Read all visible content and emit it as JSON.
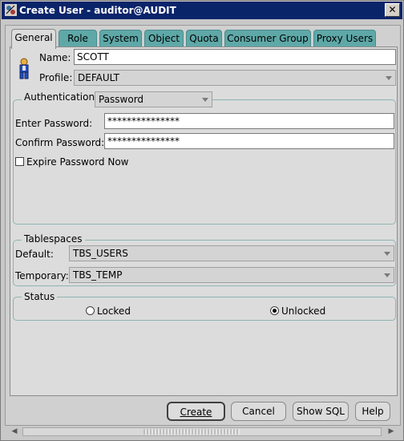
{
  "window": {
    "title": "Create User - auditor@AUDIT",
    "close_glyph": "✕"
  },
  "tabs": [
    {
      "label": "General",
      "active": true
    },
    {
      "label": "Role"
    },
    {
      "label": "System"
    },
    {
      "label": "Object"
    },
    {
      "label": "Quota"
    },
    {
      "label": "Consumer Group"
    },
    {
      "label": "Proxy Users"
    }
  ],
  "general": {
    "name_label": "Name:",
    "name_value": "SCOTT",
    "profile_label": "Profile:",
    "profile_value": "DEFAULT",
    "user_icon": "user-icon"
  },
  "authentication": {
    "legend": "Authentication",
    "type_value": "Password",
    "enter_label": "Enter Password:",
    "enter_value": "***************",
    "confirm_label": "Confirm Password:",
    "confirm_value": "***************",
    "expire_label": "Expire Password Now",
    "expire_checked": false
  },
  "tablespaces": {
    "legend": "Tablespaces",
    "default_label": "Default:",
    "default_value": "TBS_USERS",
    "temporary_label": "Temporary:",
    "temporary_value": "TBS_TEMP"
  },
  "status": {
    "legend": "Status",
    "locked_label": "Locked",
    "unlocked_label": "Unlocked",
    "selected": "Unlocked"
  },
  "buttons": {
    "create": "Create",
    "cancel": "Cancel",
    "show_sql": "Show SQL",
    "help": "Help"
  },
  "colors": {
    "title_bg": "#0a246a",
    "tab_inactive": "#5fa8a8",
    "panel_bg": "#dcdcdc"
  }
}
